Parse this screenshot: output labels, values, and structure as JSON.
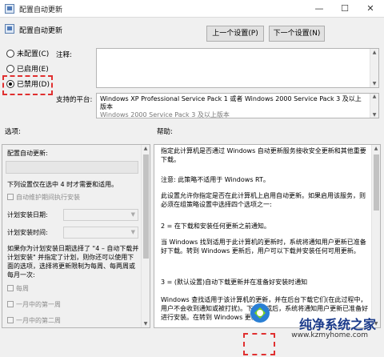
{
  "window": {
    "title": "配置自动更新",
    "minimize": "—",
    "maximize": "☐",
    "close": "✕"
  },
  "header": {
    "title": "配置自动更新",
    "prev_button": "上一个设置(P)",
    "next_button": "下一个设置(N)"
  },
  "state": {
    "not_configured": "未配置(C)",
    "enabled": "已启用(E)",
    "disabled": "已禁用(D)",
    "selected": "disabled"
  },
  "comment": {
    "label": "注释:"
  },
  "supported": {
    "label": "支持的平台:",
    "text_line1": "Windows XP Professional Service Pack 1 或者 Windows 2000 Service Pack 3 及以上",
    "text_line2": "版本",
    "text_line3": "Windows 2000 Service Pack 3 及以上版本"
  },
  "options": {
    "label": "选项:",
    "configure_label": "配置自动更新:",
    "note": "下列设置仅在选中 4 时才需要和适用。",
    "maint_checkbox": "自动维护期间执行安装",
    "install_day_label": "计划安装日期:",
    "install_time_label": "计划安装时间:",
    "info_text": "如果你为计划安装日期选择了 \"4 – 自动下载并计划安装\" 并指定了计划，则你还可以使用下面的选项，选择将更新限制为每周、每两周或每月一次:",
    "weekly": "每周",
    "first_week": "一月中的第一周",
    "second_week": "一月中的第二周"
  },
  "help": {
    "label": "帮助:",
    "p1": "指定此计算机是否通过 Windows 自动更新服务接收安全更新和其他重要下载。",
    "p2": "注意: 此策略不适用于 Windows RT。",
    "p3": "此设置允许你指定是否在此计算机上启用自动更新。如果启用该服务，则必须在组策略设置中选择四个选项之一:",
    "p4": "2 = 在下载和安装任何更新之前通知。",
    "p5": "当 Windows 找到适用于此计算机的更新时，系统将通知用户更新已准备好下载。转到 Windows 更新后，用户可以下载并安装任何可用更新。",
    "p6": "3 = (默认设置)自动下载更新并在准备好安装时通知",
    "p7": "Windows 查找适用于该计算机的更新，并在后台下载它们(在此过程中，用户不会收到通知或被打扰)。下载完成后，系统将通知用户更新已准备好进行安装。在转到 Windows 更新后，"
  },
  "watermark": {
    "text": "纯净系统之家",
    "url": "www.kzmyhome.com"
  },
  "colors": {
    "highlight": "#e03030",
    "bg": "#f0f0f0"
  }
}
